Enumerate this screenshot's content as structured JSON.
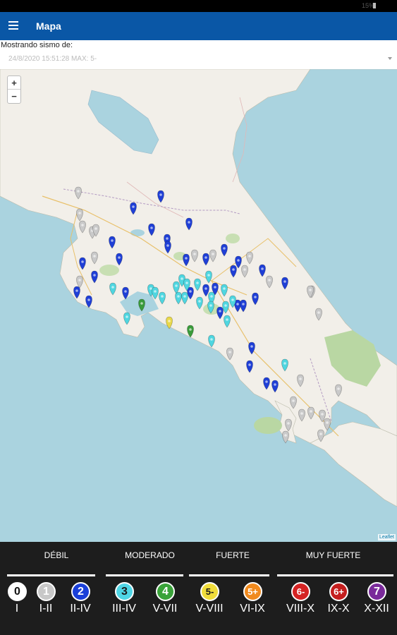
{
  "status_bar": {
    "text": "15%"
  },
  "app_bar": {
    "title": "Mapa",
    "menu_icon": "hamburger-menu-icon"
  },
  "picker": {
    "label": "Mostrando sismo de:",
    "value": "24/8/2020 15:51:28 MAX: 5-"
  },
  "map": {
    "zoom_in": "+",
    "zoom_out": "−",
    "attribution": "Leaflet",
    "pin_colors": {
      "grey": "#c9c9c9",
      "blue": "#1f3fd6",
      "cyan": "#4fd6e0",
      "green": "#3a9b3a",
      "yellow": "#e8d84a"
    }
  },
  "legend": {
    "categories": [
      {
        "label": "DÉBIL"
      },
      {
        "label": "MODERADO"
      },
      {
        "label": "FUERTE"
      },
      {
        "label": "MUY FUERTE"
      }
    ],
    "levels": [
      {
        "badge": "0",
        "roman": "I",
        "color": "#ffffff",
        "text_color": "#111111"
      },
      {
        "badge": "1",
        "roman": "I-II",
        "color": "#c8c8c8",
        "text_color": "#ffffff"
      },
      {
        "badge": "2",
        "roman": "II-IV",
        "color": "#1a3fd8",
        "text_color": "#ffffff"
      },
      {
        "badge": "3",
        "roman": "III-IV",
        "color": "#4fd6e6",
        "text_color": "#1a1a1a"
      },
      {
        "badge": "4",
        "roman": "V-VII",
        "color": "#3aa33a",
        "text_color": "#ffffff"
      },
      {
        "badge": "5-",
        "roman": "V-VIII",
        "color": "#f0dc3a",
        "text_color": "#1a1a1a"
      },
      {
        "badge": "5+",
        "roman": "VI-IX",
        "color": "#f08a1e",
        "text_color": "#ffffff"
      },
      {
        "badge": "6-",
        "roman": "VIII-X",
        "color": "#d52323",
        "text_color": "#ffffff"
      },
      {
        "badge": "6+",
        "roman": "IX-X",
        "color": "#c41e1e",
        "text_color": "#ffffff"
      },
      {
        "badge": "7",
        "roman": "X-XII",
        "color": "#7a2a9a",
        "text_color": "#ffffff"
      }
    ]
  }
}
